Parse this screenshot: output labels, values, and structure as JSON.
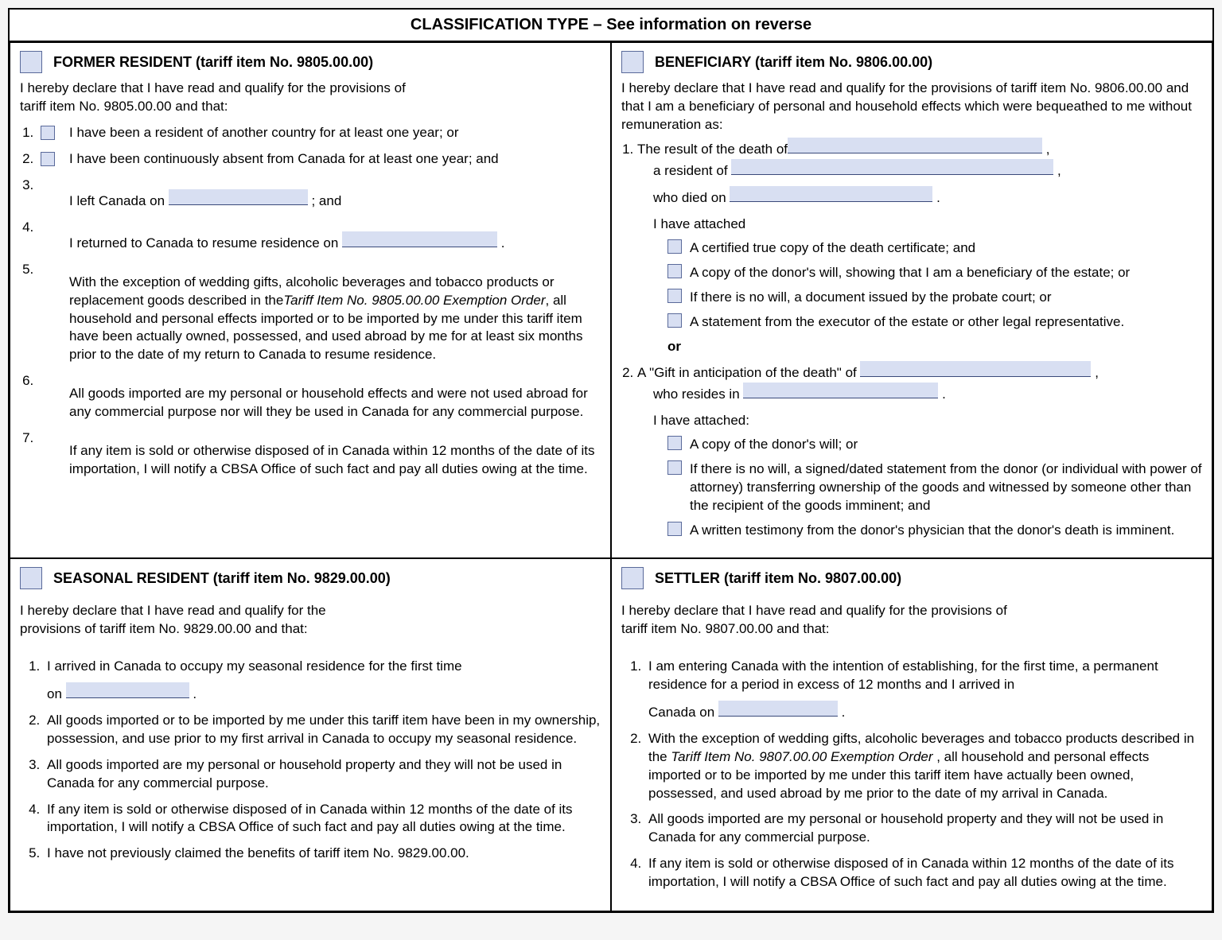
{
  "header": "CLASSIFICATION TYPE – See information on reverse",
  "former": {
    "title": "FORMER RESIDENT (tariff item No. 9805.00.00)",
    "intro": "I hereby declare that I have read and qualify for the provisions of tariff item No. 9805.00.00 and that:",
    "li1": "I have been a resident of another country for at least one year; or",
    "li2": "I have been continuously absent from Canada for at least one year; and",
    "li3a": "I left Canada on ",
    "li3b": " ; and",
    "li4a": "I returned to Canada to resume residence on ",
    "li4b": " .",
    "li5a": "With the exception of wedding gifts, alcoholic beverages and tobacco products or replacement goods described in the",
    "li5i": "Tariff Item No. 9805.00.00 Exemption Order",
    "li5b": ", all household and personal effects imported or to be imported by me under this tariff item have been actually owned, possessed, and used abroad by me for at least six months prior to the date of my return to Canada to resume residence.",
    "li6": "All goods imported are my personal or household effects and were not used abroad for any commercial purpose nor will they be used in Canada for any commercial purpose.",
    "li7": "If any item is sold or otherwise disposed of in Canada within 12 months of the date of its importation, I will notify a CBSA Office of such fact and pay all duties owing at the time."
  },
  "beneficiary": {
    "title": "BENEFICIARY (tariff item No. 9806.00.00)",
    "intro": "I hereby declare that I have read and qualify for the provisions of tariff item No. 9806.00.00 and that I am a beneficiary of personal and household effects which were bequeathed to me without remuneration as:",
    "li1a": "The result of the death of",
    "li1b": "a resident of",
    "li1c": "who died on",
    "attached1": "I have attached",
    "a1": "A certified true copy of the death certificate; and",
    "a2": "A copy of the donor's will, showing that I am a beneficiary of the estate; or",
    "a3": "If there is no will, a document issued by the probate court; or",
    "a4": "A statement from the executor of the estate or other legal representative.",
    "or": "or",
    "li2a": "A \"Gift in anticipation of the death\" of ",
    "li2b": "who resides in",
    "attached2": "I have attached:",
    "b1": "A copy of the donor's will; or",
    "b2": "If there is no will, a signed/dated statement from the donor (or individual with power of attorney) transferring ownership of the goods and witnessed by someone other than the recipient of the goods imminent; and",
    "b3": "A written testimony from the donor's physician that the donor's death is  imminent."
  },
  "seasonal": {
    "title": "SEASONAL RESIDENT (tariff item No. 9829.00.00)",
    "intro": "I hereby declare that I have read and qualify for the provisions of tariff item No. 9829.00.00 and that:",
    "li1a": "I arrived in Canada to occupy my seasonal residence for the first time",
    "li1b": "on ",
    "li1c": " .",
    "li2": "All goods imported or to be imported by me under this tariff item have been in my ownership, possession, and use prior to my first arrival in Canada to occupy my seasonal residence.",
    "li3": "All goods imported are my personal or household property and they will not be used in Canada for any commercial purpose.",
    "li4": "If any item is sold or otherwise disposed of in Canada within 12 months of the date of its importation, I will notify a CBSA Office of such fact and pay all duties owing at the time.",
    "li5": "I have not previously claimed the benefits of tariff item No. 9829.00.00."
  },
  "settler": {
    "title": "SETTLER (tariff item No. 9807.00.00)",
    "intro": "I hereby declare that I have read and qualify for the provisions of tariff item No. 9807.00.00 and that:",
    "li1a": "I am entering Canada with the intention of establishing, for the first time, a permanent residence for a period in excess of 12 months and I arrived in",
    "li1b": "Canada on ",
    "li1c": " .",
    "li2a": "With the exception of wedding gifts, alcoholic beverages and tobacco products described in the  ",
    "li2i": "Tariff Item No. 9807.00.00 Exemption Order ",
    "li2b": ", all household and personal effects imported or to be imported by me under this tariff item have actually been owned, possessed, and used abroad by me prior to the date of my arrival in Canada.",
    "li3": "All goods imported are my personal or household property and they will not be used in Canada for any commercial purpose.",
    "li4": "If any item is sold or otherwise disposed of in Canada within 12 months of the date of its importation, I will notify a CBSA Office of such fact and pay all duties owing at the time."
  }
}
